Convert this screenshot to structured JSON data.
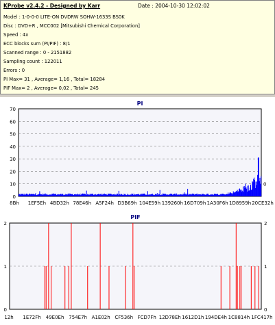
{
  "header": {
    "title": "KProbe v2.4.2 - Designed by Karr",
    "date": "Date : 2004-10-30 12:02:02"
  },
  "info_lines": [
    "Model : 1-0-0-0 LITE-ON DVDRW SOHW-1633S BS0K",
    "Disc : DVD+R , MCC002 [Mitsubishi Chemical Corporation]",
    "Speed : 4x",
    "ECC blocks sum (PI/PIF) : 8/1",
    "Scanned range : 0 - 2151882",
    "Sampling count : 122011",
    "Errors : 0",
    "PI Max= 31 , Average= 1,16 , Total= 18284",
    "PIF Max= 2 , Average= 0,02 , Total= 245"
  ],
  "colors": {
    "pi_series": "#0000ff",
    "pif_series": "#ff0000",
    "plot_bg": "#f5f5fa",
    "grid": "#808080",
    "title": "#000080"
  },
  "chart_data": [
    {
      "type": "bar",
      "title": "PI",
      "ylim": [
        0,
        70
      ],
      "y_ticks": [
        "0",
        "10",
        "20",
        "30",
        "40",
        "50",
        "60",
        "70"
      ],
      "right_tick": "0",
      "x_ticks": [
        "8Bh",
        "1EF5Eh",
        "4BD32h",
        "78E46h",
        "A5F24h",
        "D3B69h",
        "104E59h",
        "139260h",
        "16D709h",
        "1A30F6h",
        "1D8959h",
        "20CE32h"
      ],
      "grid": true,
      "peak_value": 31,
      "series_color": "#0000ff"
    },
    {
      "type": "bar",
      "title": "PIF",
      "ylim": [
        0,
        2
      ],
      "y_ticks": [
        "0",
        "1",
        "2"
      ],
      "right_ticks": [
        "0",
        "1",
        "2"
      ],
      "x_ticks": [
        "12h",
        "1E72Fh",
        "49E0Eh",
        "754E7h",
        "A1E02h",
        "CF536h",
        "FCD7Fh",
        "12D78Eh",
        "1612D1h",
        "194DE4h",
        "1C8814h",
        "1FC417h"
      ],
      "grid": true,
      "spikes": [
        {
          "x": 0.14,
          "value": 1
        },
        {
          "x": 0.145,
          "value": 1
        },
        {
          "x": 0.155,
          "value": 2
        },
        {
          "x": 0.165,
          "value": 1
        },
        {
          "x": 0.22,
          "value": 1
        },
        {
          "x": 0.235,
          "value": 1
        },
        {
          "x": 0.245,
          "value": 2
        },
        {
          "x": 0.31,
          "value": 1
        },
        {
          "x": 0.36,
          "value": 2
        },
        {
          "x": 0.395,
          "value": 1
        },
        {
          "x": 0.46,
          "value": 1
        },
        {
          "x": 0.49,
          "value": 2
        },
        {
          "x": 0.495,
          "value": 1
        },
        {
          "x": 0.84,
          "value": 1
        },
        {
          "x": 0.875,
          "value": 1
        },
        {
          "x": 0.9,
          "value": 2
        },
        {
          "x": 0.905,
          "value": 1
        },
        {
          "x": 0.915,
          "value": 1
        },
        {
          "x": 0.92,
          "value": 1
        },
        {
          "x": 0.96,
          "value": 1
        },
        {
          "x": 0.975,
          "value": 1
        },
        {
          "x": 0.99,
          "value": 1
        }
      ],
      "series_color": "#ff0000"
    }
  ]
}
